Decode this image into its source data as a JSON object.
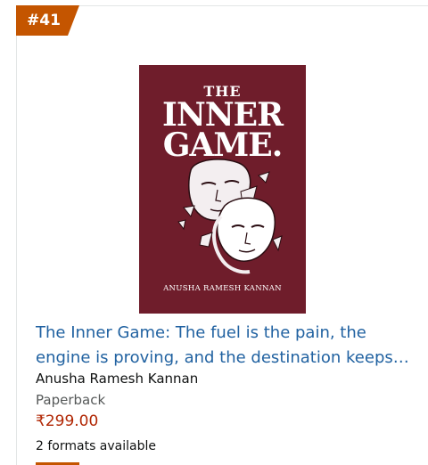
{
  "rank_badge": {
    "label": "#41",
    "color": "#c45500"
  },
  "book": {
    "cover": {
      "the": "THE",
      "title_line1": "INNER",
      "title_line2": "GAME.",
      "author": "ANUSHA RAMESH KANNAN",
      "background_color": "#6f1d2b",
      "illustration_icon": "cracked-masks-illustration"
    },
    "title_line1": "The Inner Game: The fuel is the pain, the",
    "title_line2": "engine is proving, and the destination keeps…",
    "author": "Anusha Ramesh Kannan",
    "format": "Paperback",
    "price": "₹299.00",
    "formats_available": "2 formats available"
  },
  "colors": {
    "link": "#2162a1",
    "price": "#b12704",
    "secondary_text": "#565959"
  }
}
